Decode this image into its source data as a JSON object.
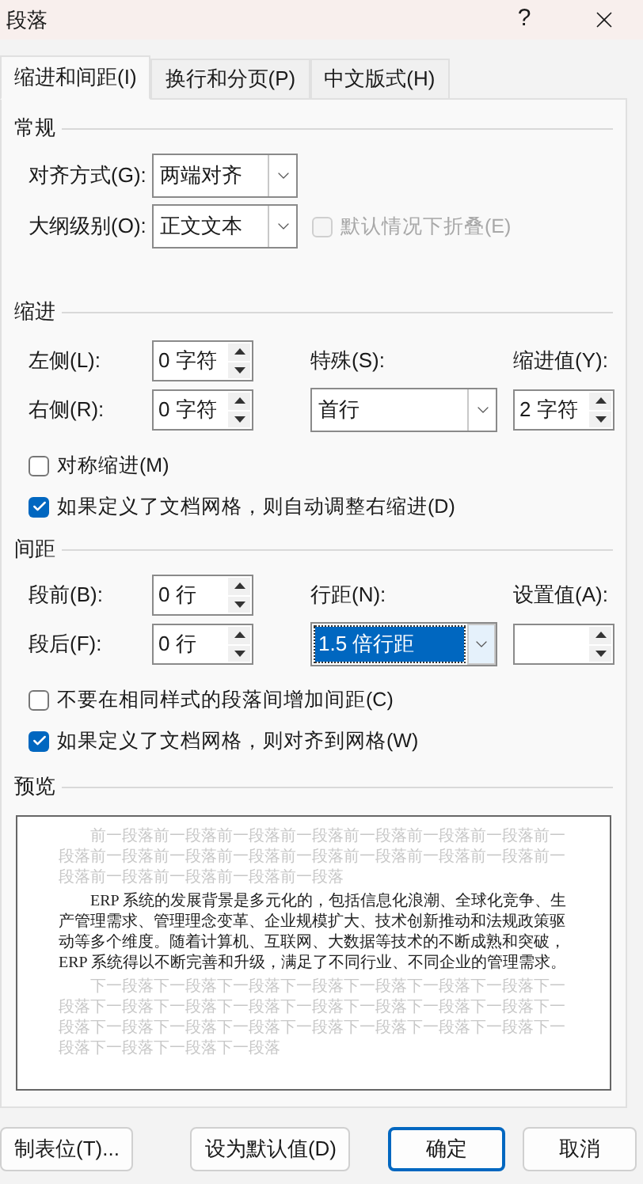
{
  "window": {
    "title": "段落",
    "help": "?"
  },
  "tabs": [
    {
      "label": "缩进和间距(I)",
      "selected": true
    },
    {
      "label": "换行和分页(P)",
      "selected": false
    },
    {
      "label": "中文版式(H)",
      "selected": false
    }
  ],
  "general": {
    "title": "常规",
    "alignment": {
      "label": "对齐方式(G):",
      "value": "两端对齐"
    },
    "outline": {
      "label": "大纲级别(O):",
      "value": "正文文本"
    },
    "collapse": {
      "label": "默认情况下折叠(E)",
      "checked": false,
      "disabled": true
    }
  },
  "indent": {
    "title": "缩进",
    "left": {
      "label": "左侧(L):",
      "value": "0 字符"
    },
    "right": {
      "label": "右侧(R):",
      "value": "0 字符"
    },
    "special": {
      "label": "特殊(S):",
      "value": "首行"
    },
    "by": {
      "label": "缩进值(Y):",
      "value": "2 字符"
    },
    "checkboxes": [
      {
        "label": "对称缩进(M)",
        "checked": false
      },
      {
        "label": "如果定义了文档网格，则自动调整右缩进(D)",
        "checked": true
      }
    ]
  },
  "spacing": {
    "title": "间距",
    "before": {
      "label": "段前(B):",
      "value": "0 行"
    },
    "after": {
      "label": "段后(F):",
      "value": "0 行"
    },
    "line": {
      "label": "行距(N):",
      "value": "1.5 倍行距",
      "selected": true
    },
    "at": {
      "label": "设置值(A):"
    },
    "checkboxes": [
      {
        "label": "不要在相同样式的段落间增加间距(C)",
        "checked": false
      },
      {
        "label": "如果定义了文档网格，则对齐到网格(W)",
        "checked": true
      }
    ]
  },
  "preview": {
    "title": "预览",
    "previous": "前一段落前一段落前一段落前一段落前一段落前一段落前一段落前一段落前一段落前一段落前一段落前一段落前一段落前一段落前一段落前一段落前一段落前一段落前一段落前一段落",
    "text": "ERP 系统的发展背景是多元化的，包括信息化浪潮、全球化竞争、生产管理需求、管理理念变革、企业规模扩大、技术创新推动和法规政策驱动等多个维度。随着计算机、互联网、大数据等技术的不断成熟和突破，ERP 系统得以不断完善和升级，满足了不同行业、不同企业的管理需求。",
    "next": "下一段落下一段落下一段落下一段落下一段落下一段落下一段落下一段落下一段落下一段落下一段落下一段落下一段落下一段落下一段落下一段落下一段落下一段落下一段落下一段落下一段落下一段落下一段落下一段落下一段落下一段落下一段落"
  },
  "buttons": [
    {
      "label": "制表位(T)...",
      "default": false
    },
    {
      "label": "设为默认值(D)",
      "default": false
    },
    {
      "label": "确定",
      "default": true
    },
    {
      "label": "取消",
      "default": false
    }
  ]
}
